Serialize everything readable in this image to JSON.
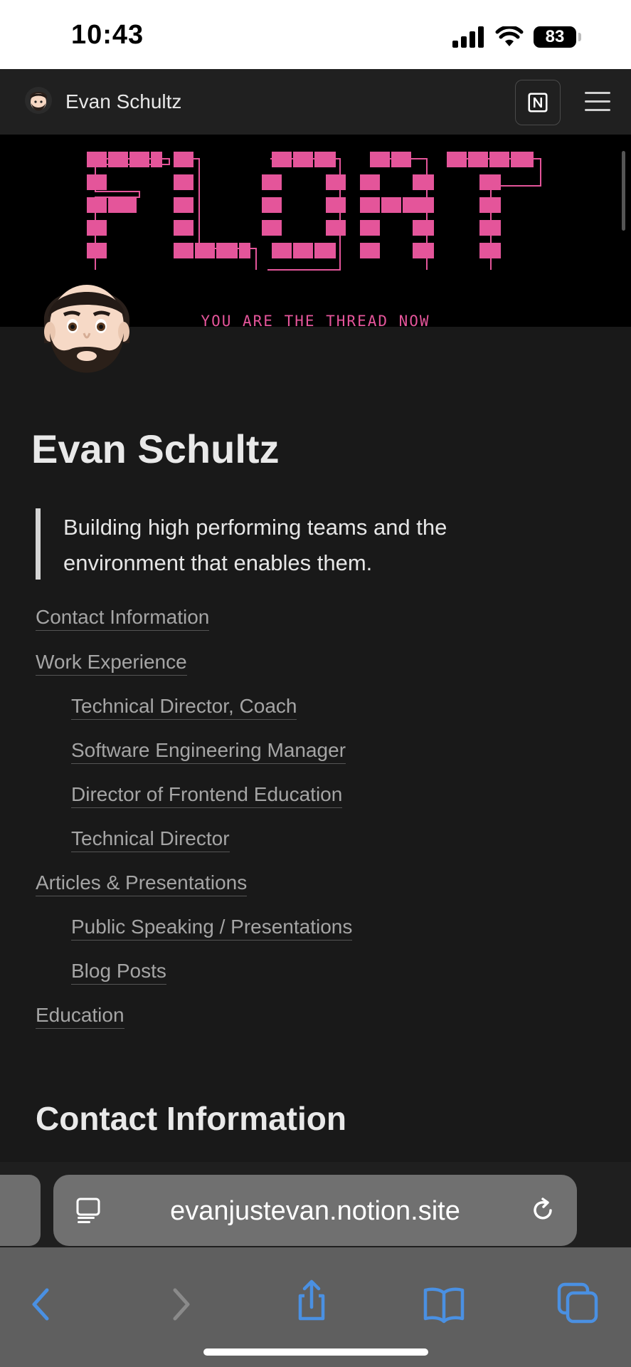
{
  "status_bar": {
    "time": "10:43",
    "battery": "83"
  },
  "topbar": {
    "title": "Evan Schultz"
  },
  "cover": {
    "tagline": "YOU ARE THE THREAD NOW"
  },
  "page": {
    "title": "Evan Schultz",
    "quote": "Building high performing teams and the environment that enables them."
  },
  "toc": [
    {
      "label": "Contact Information",
      "level": 0
    },
    {
      "label": "Work Experience",
      "level": 0
    },
    {
      "label": "Technical Director, Coach",
      "level": 1
    },
    {
      "label": "Software Engineering Manager",
      "level": 1
    },
    {
      "label": "Director of Frontend Education",
      "level": 1
    },
    {
      "label": "Technical Director",
      "level": 1
    },
    {
      "label": "Articles & Presentations",
      "level": 0
    },
    {
      "label": "Public Speaking / Presentations",
      "level": 1
    },
    {
      "label": "Blog Posts",
      "level": 1
    },
    {
      "label": "Education",
      "level": 0
    }
  ],
  "section_heading": "Contact Information",
  "browser": {
    "url": "evanjustevan.notion.site"
  },
  "colors": {
    "accent_pink": "#e4559a",
    "page_bg": "#191919",
    "ios_blue": "#4a90e2"
  }
}
